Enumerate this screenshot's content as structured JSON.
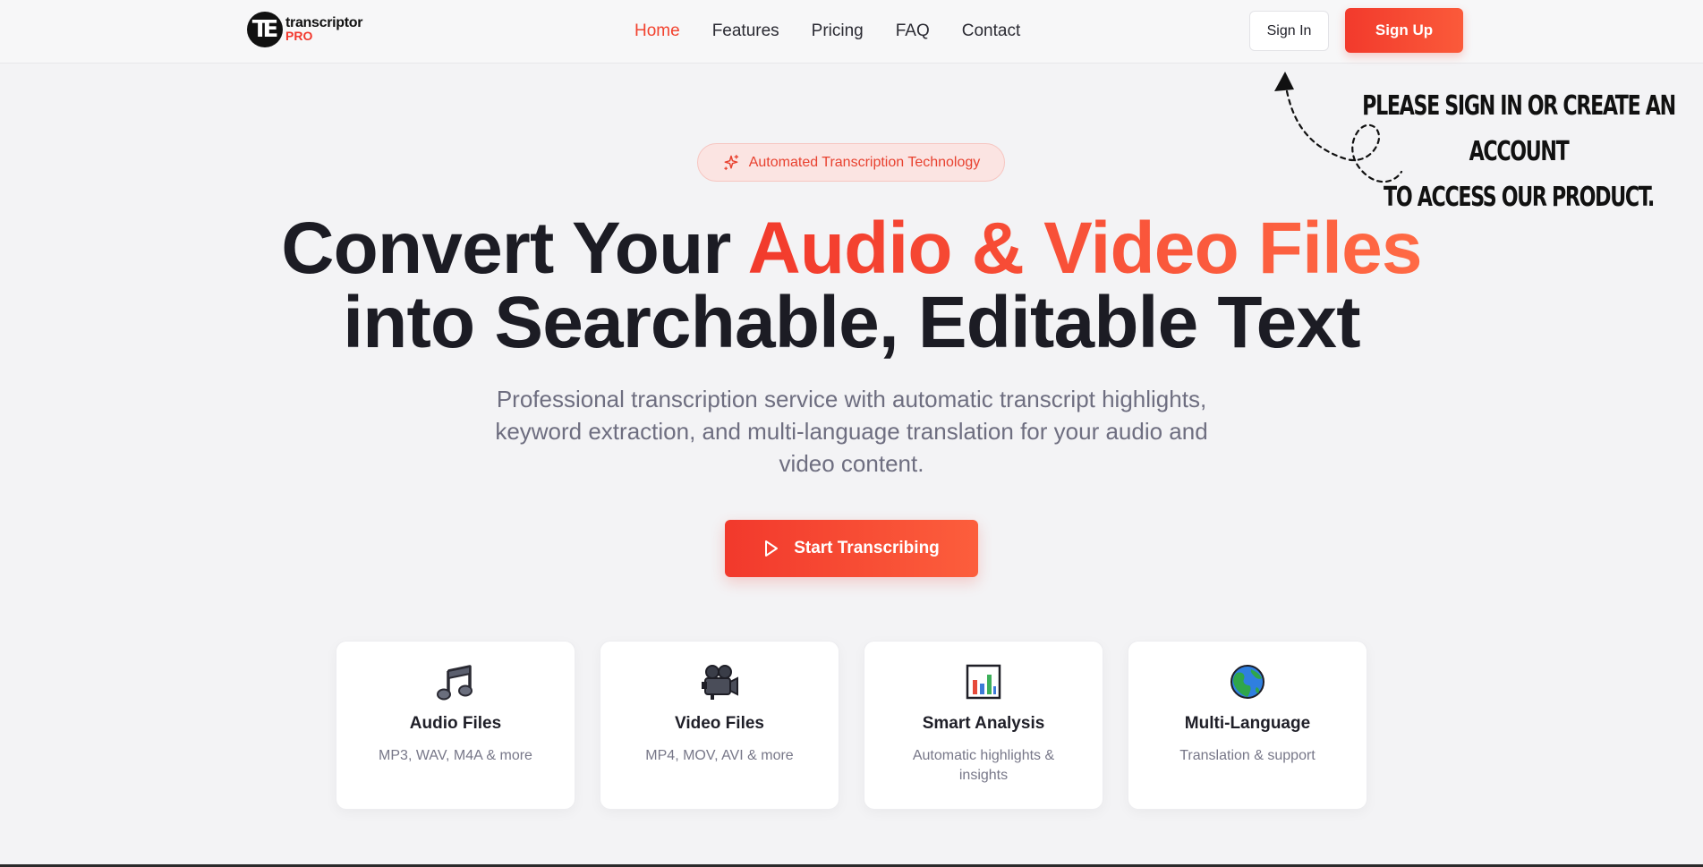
{
  "header": {
    "logo": {
      "name": "transcriptor",
      "tag": "PRO",
      "mark": "TE"
    },
    "nav": [
      {
        "label": "Home",
        "active": true
      },
      {
        "label": "Features",
        "active": false
      },
      {
        "label": "Pricing",
        "active": false
      },
      {
        "label": "FAQ",
        "active": false
      },
      {
        "label": "Contact",
        "active": false
      }
    ],
    "signin_label": "Sign In",
    "signup_label": "Sign Up"
  },
  "annotation": {
    "line1": "PLEASE SIGN IN OR CREATE AN ACCOUNT",
    "line2": "TO ACCESS OUR PRODUCT."
  },
  "hero": {
    "badge": "Automated Transcription Technology",
    "title_part1": "Convert Your ",
    "title_accent": "Audio & Video Files",
    "title_part2": "into Searchable, Editable Text",
    "subtitle": "Professional transcription service with automatic transcript highlights, keyword extraction, and multi-language translation for your audio and video content.",
    "cta_label": "Start Transcribing"
  },
  "features": [
    {
      "icon": "music-notes-icon",
      "title": "Audio Files",
      "desc": "MP3, WAV, M4A & more"
    },
    {
      "icon": "movie-camera-icon",
      "title": "Video Files",
      "desc": "MP4, MOV, AVI & more"
    },
    {
      "icon": "bar-chart-icon",
      "title": "Smart Analysis",
      "desc": "Automatic highlights & insights"
    },
    {
      "icon": "globe-icon",
      "title": "Multi-Language",
      "desc": "Translation & support"
    }
  ],
  "colors": {
    "accent": "#f2432f",
    "accent_gradient_end": "#ff6a45",
    "badge_bg": "#fbe4e2",
    "text_dark": "#1c1c24",
    "text_muted": "#6e6e80"
  }
}
